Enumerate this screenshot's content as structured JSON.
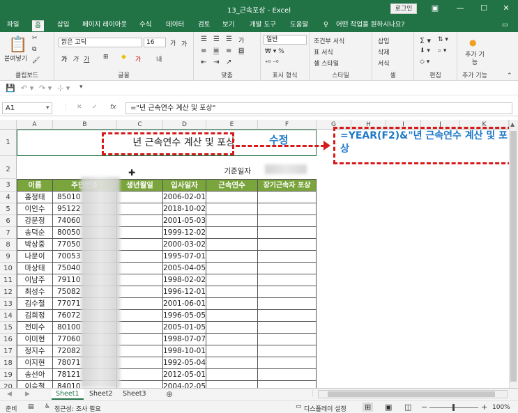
{
  "app": {
    "title": "13_근속포상 - Excel",
    "login": "로그인"
  },
  "tabs": [
    "파일",
    "홈",
    "삽입",
    "페이지 레이아웃",
    "수식",
    "데이터",
    "검토",
    "보기",
    "개발 도구",
    "도움말"
  ],
  "tellme": "어떤 작업을 원하시나요?",
  "ribbon": {
    "paste": "붙여넣기",
    "clipboard": "클립보드",
    "font_name": "맑은 고딕",
    "font_size": "16",
    "font_group": "글꼴",
    "font_grow": "가",
    "font_shrink": "가",
    "bold": "가",
    "italic": "가",
    "underline": "가",
    "phonetic": "내",
    "align_group": "맞춤",
    "wrap": "가",
    "num_format": "일반",
    "num_group": "표시 형식",
    "cond": "조건부 서식",
    "table": "표 서식",
    "cellstyle": "셀 스타일",
    "style_group": "스타일",
    "insert": "삽입",
    "delete": "삭제",
    "format": "서식",
    "cell_group": "셀",
    "edit_group": "편집",
    "addin": "추가 기능",
    "addin_group": "추가 기능"
  },
  "formula_bar": {
    "name_box": "A1",
    "fx": "fx",
    "formula": "=\"년 근속연수 계산 및 포상\""
  },
  "columns": [
    "A",
    "B",
    "C",
    "D",
    "E",
    "F",
    "G",
    "H",
    "I",
    "J",
    "K"
  ],
  "title_cell": "년 근속연수 계산 및 포상",
  "ref_label": "기준일자",
  "headers": [
    "이름",
    "주민번호",
    "생년월일",
    "입사일자",
    "근속연수",
    "장기근속자 포상"
  ],
  "rows": [
    {
      "n": "4",
      "name": "홍정태",
      "id": "85010",
      "date": "2006-02-01"
    },
    {
      "n": "5",
      "name": "이인수",
      "id": "95122",
      "date": "2018-10-02"
    },
    {
      "n": "6",
      "name": "강문정",
      "id": "74060",
      "date": "2001-05-03"
    },
    {
      "n": "7",
      "name": "송덕순",
      "id": "80050",
      "date": "1999-12-02"
    },
    {
      "n": "8",
      "name": "박상중",
      "id": "77050",
      "date": "2000-03-02"
    },
    {
      "n": "9",
      "name": "나문이",
      "id": "70053",
      "date": "1995-07-01"
    },
    {
      "n": "10",
      "name": "마상태",
      "id": "75040",
      "date": "2005-04-05"
    },
    {
      "n": "11",
      "name": "이남주",
      "id": "79110",
      "date": "1998-02-02"
    },
    {
      "n": "12",
      "name": "최성수",
      "id": "75082",
      "date": "1996-12-01"
    },
    {
      "n": "13",
      "name": "김수철",
      "id": "77071",
      "date": "2001-06-01"
    },
    {
      "n": "14",
      "name": "김희정",
      "id": "76072",
      "date": "1996-05-05"
    },
    {
      "n": "15",
      "name": "전미수",
      "id": "80100",
      "date": "2005-01-05"
    },
    {
      "n": "16",
      "name": "이미현",
      "id": "77060",
      "date": "1998-07-07"
    },
    {
      "n": "17",
      "name": "정지수",
      "id": "72082",
      "date": "1998-10-01"
    },
    {
      "n": "18",
      "name": "이지현",
      "id": "78071",
      "date": "1992-05-04"
    },
    {
      "n": "19",
      "name": "송선아",
      "id": "78121",
      "date": "2012-05-01"
    },
    {
      "n": "20",
      "name": "이승철",
      "id": "84010",
      "date": "2004-02-05"
    }
  ],
  "row_labels": [
    "1",
    "2",
    "3"
  ],
  "annotation": {
    "label": "수정",
    "formula": "=YEAR(F2)&\"년 근속연수 계산 및 포상"
  },
  "sheets": [
    "Sheet1",
    "Sheet2",
    "Sheet3"
  ],
  "status": {
    "ready": "준비",
    "access": "접근성: 조사 필요",
    "display": "디스플레이 설정",
    "zoom": "100%"
  },
  "colors": {
    "excel_green": "#217346",
    "header_green": "#7aa43c",
    "annotation_red": "#d71919",
    "annotation_blue": "#1e78c8"
  }
}
